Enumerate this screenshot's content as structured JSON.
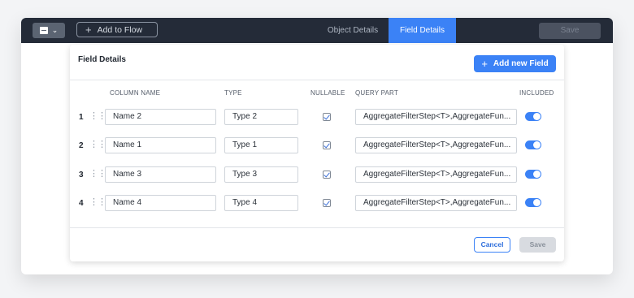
{
  "topbar": {
    "add_to_flow": "Add to Flow",
    "tabs": [
      {
        "label": "Object Details",
        "active": false
      },
      {
        "label": "Field Details",
        "active": true
      }
    ],
    "save_label": "Save"
  },
  "panel": {
    "title": "Field Details",
    "add_field_label": "Add new Field",
    "columns": [
      "COLUMN NAME",
      "TYPE",
      "NULLABLE",
      "QUERY PART",
      "INCLUDED"
    ],
    "rows": [
      {
        "index": "1",
        "name": "Name 2",
        "type": "Type 2",
        "nullable": true,
        "query": "AggregateFilterStep<T>,AggregateFun...",
        "included": true
      },
      {
        "index": "2",
        "name": "Name 1",
        "type": "Type 1",
        "nullable": true,
        "query": "AggregateFilterStep<T>,AggregateFun...",
        "included": true
      },
      {
        "index": "3",
        "name": "Name 3",
        "type": "Type 3",
        "nullable": true,
        "query": "AggregateFilterStep<T>,AggregateFun...",
        "included": true
      },
      {
        "index": "4",
        "name": "Name 4",
        "type": "Type 4",
        "nullable": true,
        "query": "AggregateFilterStep<T>,AggregateFun...",
        "included": true
      }
    ],
    "cancel_label": "Cancel",
    "save_label": "Save"
  },
  "colors": {
    "accent": "#3b82f6",
    "topbar": "#242b38"
  },
  "icons": [
    "app-menu-icon",
    "chevron-down-icon",
    "plus-icon",
    "drag-handle-icon",
    "checkbox-icon",
    "toggle-icon"
  ]
}
